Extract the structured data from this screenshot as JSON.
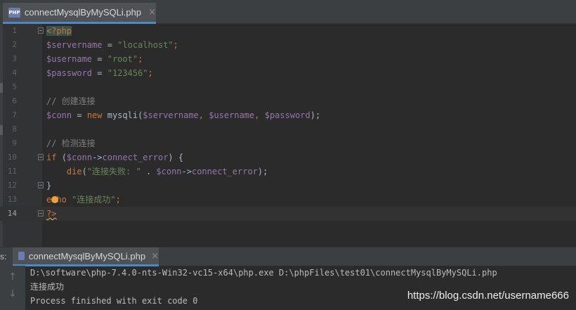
{
  "editor_tab": {
    "icon": "php-file-icon",
    "icon_text": "PHP",
    "label": "connectMysqlByMySQLi.php",
    "close": "×"
  },
  "code_lines": [
    {
      "num": "1",
      "tokens": [
        {
          "t": "<?php",
          "c": "kw hl-open"
        }
      ]
    },
    {
      "num": "2",
      "tokens": [
        {
          "t": "$servername",
          "c": "var"
        },
        {
          "t": " = ",
          "c": ""
        },
        {
          "t": "\"localhost\"",
          "c": "str"
        },
        {
          "t": ";",
          "c": "kw"
        }
      ]
    },
    {
      "num": "3",
      "tokens": [
        {
          "t": "$username",
          "c": "var"
        },
        {
          "t": " = ",
          "c": ""
        },
        {
          "t": "\"root\"",
          "c": "str"
        },
        {
          "t": ";",
          "c": "kw"
        }
      ]
    },
    {
      "num": "4",
      "tokens": [
        {
          "t": "$password",
          "c": "var"
        },
        {
          "t": " = ",
          "c": ""
        },
        {
          "t": "\"123456\"",
          "c": "str"
        },
        {
          "t": ";",
          "c": "kw"
        }
      ]
    },
    {
      "num": "5",
      "tokens": []
    },
    {
      "num": "6",
      "tokens": [
        {
          "t": "// 创建连接",
          "c": "cmt"
        }
      ]
    },
    {
      "num": "7",
      "tokens": [
        {
          "t": "$conn",
          "c": "var"
        },
        {
          "t": " = ",
          "c": ""
        },
        {
          "t": "new ",
          "c": "kw"
        },
        {
          "t": "mysqli(",
          "c": ""
        },
        {
          "t": "$servername",
          "c": "var"
        },
        {
          "t": ", ",
          "c": "kw"
        },
        {
          "t": "$username",
          "c": "var"
        },
        {
          "t": ", ",
          "c": "kw"
        },
        {
          "t": "$password",
          "c": "var"
        },
        {
          "t": ");",
          "c": ""
        }
      ]
    },
    {
      "num": "8",
      "tokens": []
    },
    {
      "num": "9",
      "tokens": [
        {
          "t": "// 检测连接",
          "c": "cmt"
        }
      ]
    },
    {
      "num": "10",
      "tokens": [
        {
          "t": "if ",
          "c": "kw"
        },
        {
          "t": "(",
          "c": ""
        },
        {
          "t": "$conn",
          "c": "var"
        },
        {
          "t": "->",
          "c": ""
        },
        {
          "t": "connect_error",
          "c": "var"
        },
        {
          "t": ") {",
          "c": ""
        }
      ]
    },
    {
      "num": "11",
      "tokens": [
        {
          "t": "    die",
          "c": "kw"
        },
        {
          "t": "(",
          "c": ""
        },
        {
          "t": "\"连接失败: \"",
          "c": "str"
        },
        {
          "t": " . ",
          "c": ""
        },
        {
          "t": "$conn",
          "c": "var"
        },
        {
          "t": "->",
          "c": ""
        },
        {
          "t": "connect_error",
          "c": "var"
        },
        {
          "t": ");",
          "c": ""
        }
      ]
    },
    {
      "num": "12",
      "tokens": [
        {
          "t": "}",
          "c": ""
        }
      ]
    },
    {
      "num": "13",
      "tokens": [
        {
          "t": "echo ",
          "c": "kw"
        },
        {
          "t": "\"连接成功\"",
          "c": "str"
        },
        {
          "t": ";",
          "c": "kw"
        }
      ]
    },
    {
      "num": "14",
      "tokens": [
        {
          "t": "?>",
          "c": "kw squig"
        }
      ]
    }
  ],
  "run_window": {
    "label": "s:",
    "tab_label": "connectMysqlByMySQLi.php",
    "tab_icon": "php-run-icon",
    "close": "×",
    "side_up": "↑",
    "side_down": "↓",
    "console": [
      "D:\\software\\php-7.4.0-nts-Win32-vc15-x64\\php.exe D:\\phpFiles\\test01\\connectMysqlByMySQLi.php",
      "连接成功",
      "Process finished with exit code 0"
    ]
  },
  "watermark": "https://blog.csdn.net/username666"
}
